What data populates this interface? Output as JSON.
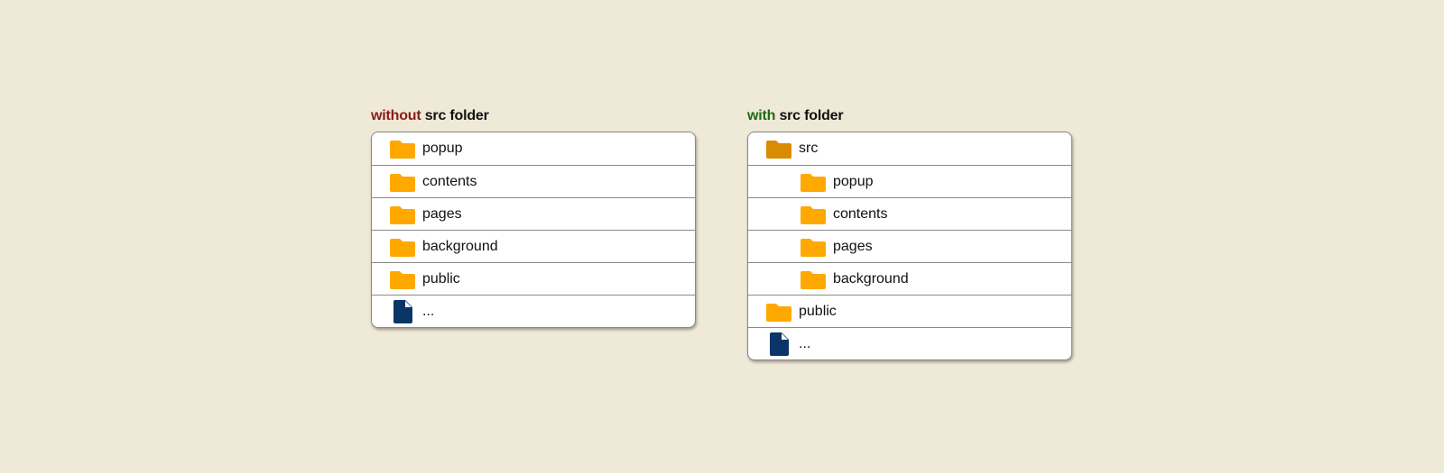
{
  "colors": {
    "background": "#efe9d7",
    "folder": "#ffa800",
    "folder_src": "#d98c00",
    "file": "#0b3566",
    "negative_accent": "#8b1a1a",
    "positive_accent": "#1d6b14"
  },
  "panels": {
    "without": {
      "title_accent": "without",
      "title_rest": " src folder",
      "items": [
        {
          "label": "popup",
          "type": "folder"
        },
        {
          "label": "contents",
          "type": "folder"
        },
        {
          "label": "pages",
          "type": "folder"
        },
        {
          "label": "background",
          "type": "folder"
        },
        {
          "label": "public",
          "type": "folder"
        },
        {
          "label": "...",
          "type": "file"
        }
      ]
    },
    "with": {
      "title_accent": "with",
      "title_rest": " src folder",
      "items": [
        {
          "label": "src",
          "type": "folder-src",
          "depth": 0
        },
        {
          "label": "popup",
          "type": "folder",
          "depth": 1
        },
        {
          "label": "contents",
          "type": "folder",
          "depth": 1
        },
        {
          "label": "pages",
          "type": "folder",
          "depth": 1
        },
        {
          "label": "background",
          "type": "folder",
          "depth": 1
        },
        {
          "label": "public",
          "type": "folder",
          "depth": 0
        },
        {
          "label": "...",
          "type": "file",
          "depth": 0
        }
      ]
    }
  }
}
